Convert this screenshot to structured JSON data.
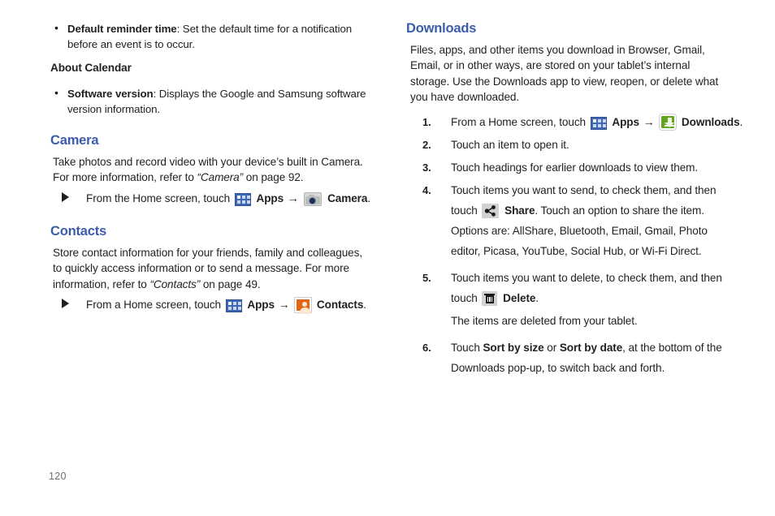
{
  "page": {
    "number": "120"
  },
  "colors": {
    "heading": "#3c5cab",
    "body_text": "#231f20",
    "page_number": "#6d6e71",
    "apps_icon": "#3e68b5",
    "contacts_icon": "#e36413",
    "downloads_icon": "#62a51e",
    "share_icon_bg": "#d2d2d2",
    "delete_icon_bg": "#d2d2d2",
    "camera_icon": "#d9d9d9"
  },
  "left_column": {
    "calendar_bullet": {
      "term": "Default reminder time",
      "description": ": Set the default time for a notification before an event is to occur."
    },
    "about_calendar_heading": "About Calendar",
    "software_bullet": {
      "term": "Software version",
      "description": ": Displays the Google and Samsung software version information."
    },
    "camera": {
      "heading": "Camera",
      "paragraph_line1": "Take photos and record video with your device’s built in Camera.",
      "paragraph_line2_pre": "For more information, refer to ",
      "paragraph_line2_ref": "“Camera”",
      "paragraph_line2_post": " on page 92.",
      "step": {
        "pre": "From the Home screen, touch",
        "apps_label": "Apps",
        "arrow": "→",
        "target_label": "Camera",
        "period": "."
      }
    },
    "contacts": {
      "heading": "Contacts",
      "paragraph_line1": "Store contact information for your friends, family and colleagues,",
      "paragraph_line2": "to quickly access information or to send a message. For more",
      "paragraph_line3_pre": "information, refer to ",
      "paragraph_line3_ref": "“Contacts”",
      "paragraph_line3_post": " on page 49.",
      "step": {
        "pre": "From a Home screen, touch",
        "apps_label": "Apps",
        "arrow": "→",
        "target_label": "Contacts",
        "period": "."
      }
    }
  },
  "right_column": {
    "downloads": {
      "heading": "Downloads",
      "intro_line1": "Files, apps, and other items you download in Browser, Gmail,",
      "intro_line2": "Email, or in other ways, are stored on your tablet’s internal",
      "intro_line3": "storage. Use the Downloads app to view, reopen, or delete what",
      "intro_line4": "you have downloaded.",
      "steps": [
        {
          "number": "1.",
          "pre": "From a Home screen, touch",
          "apps_label": "Apps",
          "arrow": "→",
          "target_label": "Downloads",
          "period": "."
        },
        {
          "number": "2.",
          "text": "Touch an item to open it."
        },
        {
          "number": "3.",
          "text": "Touch headings for earlier downloads to view them."
        },
        {
          "number": "4.",
          "line1": "Touch items you want to send, to check them, and then",
          "line2_pre": "touch",
          "line2_bold": "Share",
          "line2_post": ". Touch an option to share the item.",
          "line3": "Options are: AllShare, Bluetooth, Email, Gmail, Photo",
          "line4": "editor, Picasa, YouTube, Social Hub, or Wi-Fi Direct."
        },
        {
          "number": "5.",
          "line1": "Touch items you want to delete, to check them, and then",
          "line2_pre": "touch",
          "line2_bold": "Delete",
          "line2_post": ".",
          "note": "The items are deleted from your tablet."
        },
        {
          "number": "6.",
          "line1_pre": "Touch ",
          "line1_bold1": "Sort by size",
          "line1_mid": " or ",
          "line1_bold2": "Sort by date",
          "line1_post": ", at the bottom of the",
          "line2": "Downloads pop-up, to switch back and forth."
        }
      ]
    }
  }
}
